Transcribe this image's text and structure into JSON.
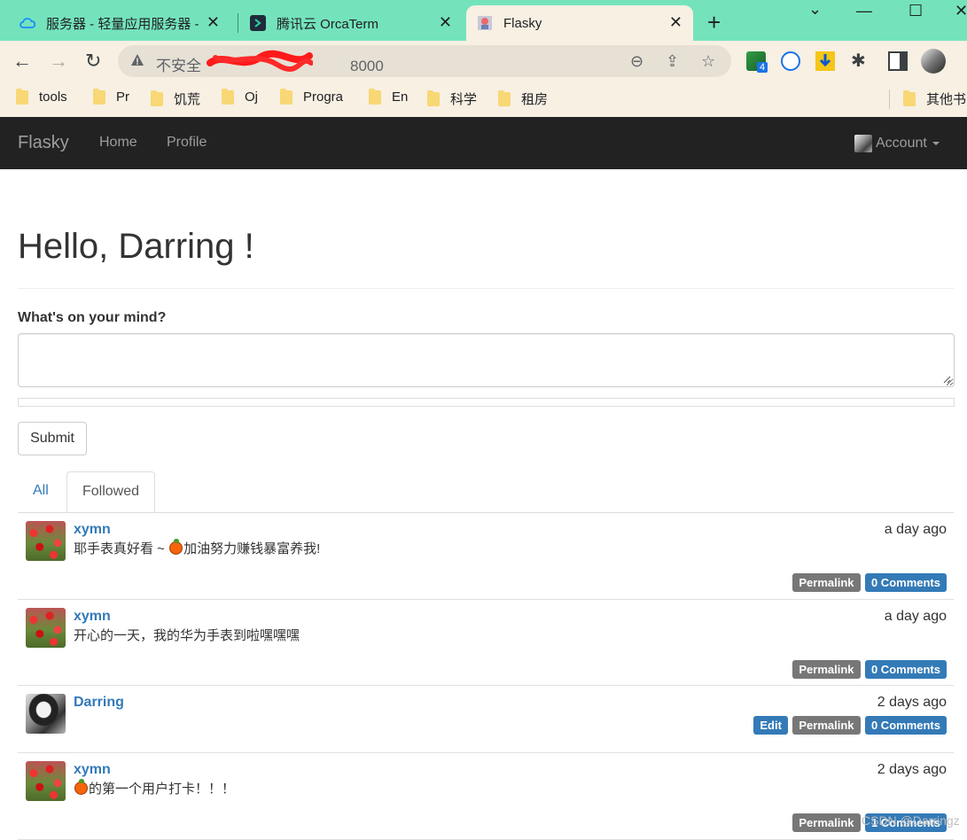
{
  "browser": {
    "tabs": [
      {
        "title": "服务器 - 轻量应用服务器 -",
        "icon": "cloud-icon",
        "active": false
      },
      {
        "title": "腾讯云 OrcaTerm",
        "icon": "terminal-icon",
        "active": false
      },
      {
        "title": "Flasky",
        "icon": "flasky-favicon",
        "active": true
      }
    ],
    "new_tab": "+",
    "window_controls": {
      "minimize": "—",
      "maximize": "☐",
      "close": "✕",
      "dropdown": "⌄"
    },
    "address": {
      "security_label": "不安全",
      "visible_url_suffix": "8000"
    },
    "extension_badge": "4",
    "bookmarks": [
      "tools",
      "Pr",
      "饥荒",
      "Oj",
      "Progra",
      "En",
      "科学",
      "租房"
    ],
    "other_bookmarks": "其他书"
  },
  "navbar": {
    "brand": "Flasky",
    "links": [
      "Home",
      "Profile"
    ],
    "account": "Account"
  },
  "page": {
    "title": "Hello, Darring !",
    "form_label": "What's on your mind?",
    "body_value": "",
    "submit": "Submit",
    "tabs": [
      {
        "label": "All",
        "active": false
      },
      {
        "label": "Followed",
        "active": true
      }
    ]
  },
  "posts": [
    {
      "author": "xymn",
      "date": "a day ago",
      "body_before": "耶手表真好看 ~ ",
      "emoji": "orange-emoji",
      "body_after": "加油努力赚钱暴富养我!",
      "avatar": "tulip",
      "labels": [
        "Permalink",
        "0 Comments"
      ]
    },
    {
      "author": "xymn",
      "date": "a day ago",
      "body_before": "开心的一天，我的华为手表到啦嘿嘿嘿",
      "emoji": "",
      "body_after": "",
      "avatar": "tulip",
      "labels": [
        "Permalink",
        "0 Comments"
      ]
    },
    {
      "author": "Darring",
      "date": "2 days ago",
      "body_before": "",
      "emoji": "",
      "body_after": "",
      "avatar": "girl",
      "labels": [
        "Edit",
        "Permalink",
        "0 Comments"
      ]
    },
    {
      "author": "xymn",
      "date": "2 days ago",
      "body_before": "",
      "emoji": "orange-emoji",
      "body_after": "的第一个用户打卡！！！",
      "avatar": "tulip",
      "labels": [
        "Permalink",
        "1 Comments"
      ]
    }
  ],
  "label_colors": {
    "Edit": "#337ab7",
    "Permalink": "#777777",
    "Comments": "#337ab7"
  },
  "watermark": "CSDN @Darringz"
}
